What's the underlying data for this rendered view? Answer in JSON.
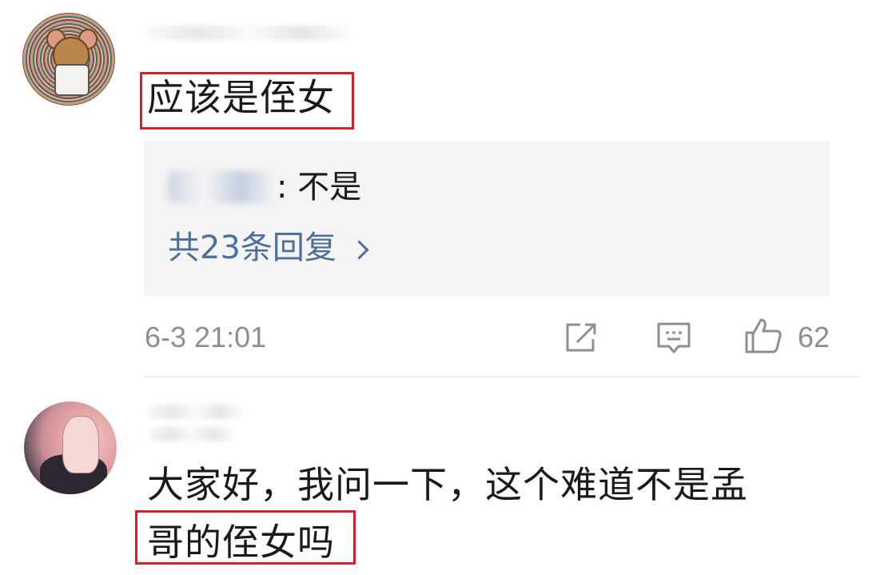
{
  "comment1": {
    "text": "应该是侄女",
    "reply": {
      "text": "不是",
      "count_label": "共23条回复"
    },
    "time": "6-3 21:01",
    "likes": "62"
  },
  "comment2": {
    "line1": "大家好，我问一下，这个难道不是孟",
    "line2": "哥的侄女吗"
  },
  "colors": {
    "highlight": "#d0232b",
    "link": "#4d6f9c",
    "meta": "#8e8e8e",
    "reply_bg": "#f4f4f4"
  },
  "icons": {
    "forward": "forward-icon",
    "comment": "comment-icon",
    "like": "thumbs-up-icon"
  }
}
